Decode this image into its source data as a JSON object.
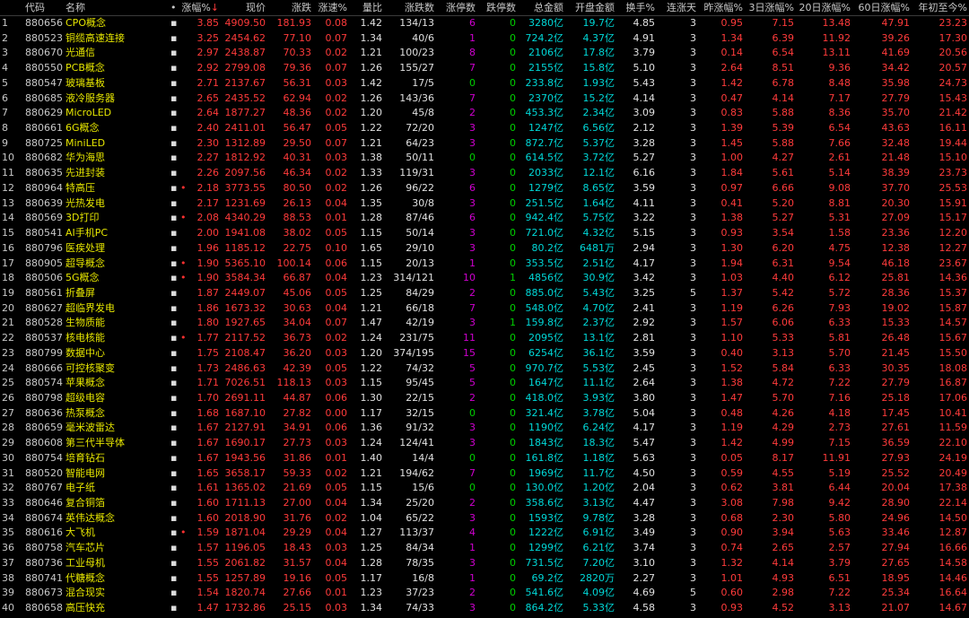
{
  "header": {
    "index": "",
    "code": "代码",
    "name": "名称",
    "flag": "•",
    "pct": "涨幅%",
    "pct_sort": "↓",
    "price": "现价",
    "chg": "涨跌",
    "speed": "涨速%",
    "volratio": "量比",
    "updown": "涨跌数",
    "up_limit": "涨停数",
    "down_limit": "跌停数",
    "amount": "总金额",
    "open_amount": "开盘金额",
    "turnover": "换手%",
    "consec": "连涨天",
    "ypct": "昨涨幅%",
    "pct3": "3日涨幅%",
    "pct20": "20日涨幅%",
    "pct60": "60日涨幅%",
    "ytd": "年初至今%"
  },
  "rows": [
    {
      "i": "1",
      "code": "880656",
      "name": "CPO概念",
      "m": "▪",
      "dot": "",
      "pct": "3.85",
      "price": "4909.50",
      "chg": "181.93",
      "speed": "0.08",
      "vr": "1.42",
      "ud": "134/13",
      "ul": "6",
      "dl": "0",
      "amt": "3280亿",
      "oamt": "19.7亿",
      "to": "4.85",
      "cd": "3",
      "yp": "0.95",
      "p3": "7.15",
      "p20": "13.48",
      "p60": "47.91",
      "ytd": "23.23"
    },
    {
      "i": "2",
      "code": "880523",
      "name": "铜缆高速连接",
      "m": "▪",
      "dot": "",
      "pct": "3.25",
      "price": "2454.62",
      "chg": "77.10",
      "speed": "0.07",
      "vr": "1.34",
      "ud": "40/6",
      "ul": "1",
      "dl": "0",
      "amt": "724.2亿",
      "oamt": "4.37亿",
      "to": "4.91",
      "cd": "3",
      "yp": "1.34",
      "p3": "6.39",
      "p20": "11.92",
      "p60": "39.26",
      "ytd": "17.30"
    },
    {
      "i": "3",
      "code": "880670",
      "name": "光通信",
      "m": "▪",
      "dot": "",
      "pct": "2.97",
      "price": "2438.87",
      "chg": "70.33",
      "speed": "0.02",
      "vr": "1.21",
      "ud": "100/23",
      "ul": "8",
      "dl": "0",
      "amt": "2106亿",
      "oamt": "17.8亿",
      "to": "3.79",
      "cd": "3",
      "yp": "0.14",
      "p3": "6.54",
      "p20": "13.11",
      "p60": "41.69",
      "ytd": "20.56"
    },
    {
      "i": "4",
      "code": "880550",
      "name": "PCB概念",
      "m": "▪",
      "dot": "",
      "pct": "2.92",
      "price": "2799.08",
      "chg": "79.36",
      "speed": "0.07",
      "vr": "1.26",
      "ud": "155/27",
      "ul": "7",
      "dl": "0",
      "amt": "2155亿",
      "oamt": "15.8亿",
      "to": "5.10",
      "cd": "3",
      "yp": "2.64",
      "p3": "8.51",
      "p20": "9.36",
      "p60": "34.42",
      "ytd": "20.57"
    },
    {
      "i": "5",
      "code": "880547",
      "name": "玻璃基板",
      "m": "▪",
      "dot": "",
      "pct": "2.71",
      "price": "2137.67",
      "chg": "56.31",
      "speed": "0.03",
      "vr": "1.42",
      "ud": "17/5",
      "ul": "0",
      "dl": "0",
      "amt": "233.8亿",
      "oamt": "1.93亿",
      "to": "5.43",
      "cd": "3",
      "yp": "1.42",
      "p3": "6.78",
      "p20": "8.48",
      "p60": "35.98",
      "ytd": "24.73"
    },
    {
      "i": "6",
      "code": "880685",
      "name": "液冷服务器",
      "m": "▪",
      "dot": "",
      "pct": "2.65",
      "price": "2435.52",
      "chg": "62.94",
      "speed": "0.02",
      "vr": "1.26",
      "ud": "143/36",
      "ul": "7",
      "dl": "0",
      "amt": "2370亿",
      "oamt": "15.2亿",
      "to": "4.14",
      "cd": "3",
      "yp": "0.47",
      "p3": "4.14",
      "p20": "7.17",
      "p60": "27.79",
      "ytd": "15.43"
    },
    {
      "i": "7",
      "code": "880629",
      "name": "MicroLED",
      "m": "▪",
      "dot": "",
      "pct": "2.64",
      "price": "1877.27",
      "chg": "48.36",
      "speed": "0.02",
      "vr": "1.20",
      "ud": "45/8",
      "ul": "2",
      "dl": "0",
      "amt": "453.3亿",
      "oamt": "2.34亿",
      "to": "3.09",
      "cd": "3",
      "yp": "0.83",
      "p3": "5.88",
      "p20": "8.36",
      "p60": "35.70",
      "ytd": "21.42"
    },
    {
      "i": "8",
      "code": "880661",
      "name": "6G概念",
      "m": "▪",
      "dot": "",
      "pct": "2.40",
      "price": "2411.01",
      "chg": "56.47",
      "speed": "0.05",
      "vr": "1.22",
      "ud": "72/20",
      "ul": "3",
      "dl": "0",
      "amt": "1247亿",
      "oamt": "6.56亿",
      "to": "2.12",
      "cd": "3",
      "yp": "1.39",
      "p3": "5.39",
      "p20": "6.54",
      "p60": "43.63",
      "ytd": "16.11"
    },
    {
      "i": "9",
      "code": "880725",
      "name": "MiniLED",
      "m": "▪",
      "dot": "",
      "pct": "2.30",
      "price": "1312.89",
      "chg": "29.50",
      "speed": "0.07",
      "vr": "1.21",
      "ud": "64/23",
      "ul": "3",
      "dl": "0",
      "amt": "872.7亿",
      "oamt": "5.37亿",
      "to": "3.28",
      "cd": "3",
      "yp": "1.45",
      "p3": "5.88",
      "p20": "7.66",
      "p60": "32.48",
      "ytd": "19.44"
    },
    {
      "i": "10",
      "code": "880682",
      "name": "华为海思",
      "m": "▪",
      "dot": "",
      "pct": "2.27",
      "price": "1812.92",
      "chg": "40.31",
      "speed": "0.03",
      "vr": "1.38",
      "ud": "50/11",
      "ul": "0",
      "dl": "0",
      "amt": "614.5亿",
      "oamt": "3.72亿",
      "to": "5.27",
      "cd": "3",
      "yp": "1.00",
      "p3": "4.27",
      "p20": "2.61",
      "p60": "21.48",
      "ytd": "15.10"
    },
    {
      "i": "11",
      "code": "880635",
      "name": "先进封装",
      "m": "▪",
      "dot": "",
      "pct": "2.26",
      "price": "2097.56",
      "chg": "46.34",
      "speed": "0.02",
      "vr": "1.33",
      "ud": "119/31",
      "ul": "3",
      "dl": "0",
      "amt": "2033亿",
      "oamt": "12.1亿",
      "to": "6.16",
      "cd": "3",
      "yp": "1.84",
      "p3": "5.61",
      "p20": "5.14",
      "p60": "38.39",
      "ytd": "23.73"
    },
    {
      "i": "12",
      "code": "880964",
      "name": "特高压",
      "m": "▪",
      "dot": "•",
      "pct": "2.18",
      "price": "3773.55",
      "chg": "80.50",
      "speed": "0.02",
      "vr": "1.26",
      "ud": "96/22",
      "ul": "6",
      "dl": "0",
      "amt": "1279亿",
      "oamt": "8.65亿",
      "to": "3.59",
      "cd": "3",
      "yp": "0.97",
      "p3": "6.66",
      "p20": "9.08",
      "p60": "37.70",
      "ytd": "25.53"
    },
    {
      "i": "13",
      "code": "880639",
      "name": "光热发电",
      "m": "▪",
      "dot": "",
      "pct": "2.17",
      "price": "1231.69",
      "chg": "26.13",
      "speed": "0.04",
      "vr": "1.35",
      "ud": "30/8",
      "ul": "3",
      "dl": "0",
      "amt": "251.5亿",
      "oamt": "1.64亿",
      "to": "4.11",
      "cd": "3",
      "yp": "0.41",
      "p3": "5.20",
      "p20": "8.81",
      "p60": "20.30",
      "ytd": "15.91"
    },
    {
      "i": "14",
      "code": "880569",
      "name": "3D打印",
      "m": "▪",
      "dot": "•",
      "pct": "2.08",
      "price": "4340.29",
      "chg": "88.53",
      "speed": "0.01",
      "vr": "1.28",
      "ud": "87/46",
      "ul": "6",
      "dl": "0",
      "amt": "942.4亿",
      "oamt": "5.75亿",
      "to": "3.22",
      "cd": "3",
      "yp": "1.38",
      "p3": "5.27",
      "p20": "5.31",
      "p60": "27.09",
      "ytd": "15.17"
    },
    {
      "i": "15",
      "code": "880541",
      "name": "AI手机PC",
      "m": "▪",
      "dot": "",
      "pct": "2.00",
      "price": "1941.08",
      "chg": "38.02",
      "speed": "0.05",
      "vr": "1.15",
      "ud": "50/14",
      "ul": "3",
      "dl": "0",
      "amt": "721.0亿",
      "oamt": "4.32亿",
      "to": "5.15",
      "cd": "3",
      "yp": "0.93",
      "p3": "3.54",
      "p20": "1.58",
      "p60": "23.36",
      "ytd": "12.20"
    },
    {
      "i": "16",
      "code": "880796",
      "name": "医疾处理",
      "m": "▪",
      "dot": "",
      "pct": "1.96",
      "price": "1185.12",
      "chg": "22.75",
      "speed": "0.10",
      "vr": "1.65",
      "ud": "29/10",
      "ul": "3",
      "dl": "0",
      "amt": "80.2亿",
      "oamt": "6481万",
      "to": "2.94",
      "cd": "3",
      "yp": "1.30",
      "p3": "6.20",
      "p20": "4.75",
      "p60": "12.38",
      "ytd": "12.27"
    },
    {
      "i": "17",
      "code": "880905",
      "name": "超导概念",
      "m": "▪",
      "dot": "•",
      "pct": "1.90",
      "price": "5365.10",
      "chg": "100.14",
      "speed": "0.06",
      "vr": "1.15",
      "ud": "20/13",
      "ul": "1",
      "dl": "0",
      "amt": "353.5亿",
      "oamt": "2.51亿",
      "to": "4.17",
      "cd": "3",
      "yp": "1.94",
      "p3": "6.31",
      "p20": "9.54",
      "p60": "46.18",
      "ytd": "23.67"
    },
    {
      "i": "18",
      "code": "880506",
      "name": "5G概念",
      "m": "▪",
      "dot": "•",
      "pct": "1.90",
      "price": "3584.34",
      "chg": "66.87",
      "speed": "0.04",
      "vr": "1.23",
      "ud": "314/121",
      "ul": "10",
      "dl": "1",
      "amt": "4856亿",
      "oamt": "30.9亿",
      "to": "3.42",
      "cd": "3",
      "yp": "1.03",
      "p3": "4.40",
      "p20": "6.12",
      "p60": "25.81",
      "ytd": "14.36"
    },
    {
      "i": "19",
      "code": "880561",
      "name": "折叠屏",
      "m": "▪",
      "dot": "",
      "pct": "1.87",
      "price": "2449.07",
      "chg": "45.06",
      "speed": "0.05",
      "vr": "1.25",
      "ud": "84/29",
      "ul": "2",
      "dl": "0",
      "amt": "885.0亿",
      "oamt": "5.43亿",
      "to": "3.25",
      "cd": "5",
      "yp": "1.37",
      "p3": "5.42",
      "p20": "5.72",
      "p60": "28.36",
      "ytd": "15.37"
    },
    {
      "i": "20",
      "code": "880627",
      "name": "超临界发电",
      "m": "▪",
      "dot": "",
      "pct": "1.86",
      "price": "1673.32",
      "chg": "30.63",
      "speed": "0.04",
      "vr": "1.21",
      "ud": "66/18",
      "ul": "7",
      "dl": "0",
      "amt": "548.0亿",
      "oamt": "4.70亿",
      "to": "2.41",
      "cd": "3",
      "yp": "1.19",
      "p3": "6.26",
      "p20": "7.93",
      "p60": "19.02",
      "ytd": "15.87"
    },
    {
      "i": "21",
      "code": "880528",
      "name": "生物质能",
      "m": "▪",
      "dot": "",
      "pct": "1.80",
      "price": "1927.65",
      "chg": "34.04",
      "speed": "0.07",
      "vr": "1.47",
      "ud": "42/19",
      "ul": "3",
      "dl": "1",
      "amt": "159.8亿",
      "oamt": "2.37亿",
      "to": "2.92",
      "cd": "3",
      "yp": "1.57",
      "p3": "6.06",
      "p20": "6.33",
      "p60": "15.33",
      "ytd": "14.57"
    },
    {
      "i": "22",
      "code": "880537",
      "name": "核电核能",
      "m": "▪",
      "dot": "•",
      "pct": "1.77",
      "price": "2117.52",
      "chg": "36.73",
      "speed": "0.02",
      "vr": "1.24",
      "ud": "231/75",
      "ul": "11",
      "dl": "0",
      "amt": "2095亿",
      "oamt": "13.1亿",
      "to": "2.81",
      "cd": "3",
      "yp": "1.10",
      "p3": "5.33",
      "p20": "5.81",
      "p60": "26.48",
      "ytd": "15.67"
    },
    {
      "i": "23",
      "code": "880799",
      "name": "数据中心",
      "m": "▪",
      "dot": "",
      "pct": "1.75",
      "price": "2108.47",
      "chg": "36.20",
      "speed": "0.03",
      "vr": "1.20",
      "ud": "374/195",
      "ul": "15",
      "dl": "0",
      "amt": "6254亿",
      "oamt": "36.1亿",
      "to": "3.59",
      "cd": "3",
      "yp": "0.40",
      "p3": "3.13",
      "p20": "5.70",
      "p60": "21.45",
      "ytd": "15.50"
    },
    {
      "i": "24",
      "code": "880666",
      "name": "可控核聚变",
      "m": "▪",
      "dot": "",
      "pct": "1.73",
      "price": "2486.63",
      "chg": "42.39",
      "speed": "0.05",
      "vr": "1.22",
      "ud": "74/32",
      "ul": "5",
      "dl": "0",
      "amt": "970.7亿",
      "oamt": "5.53亿",
      "to": "2.45",
      "cd": "3",
      "yp": "1.52",
      "p3": "5.84",
      "p20": "6.33",
      "p60": "30.35",
      "ytd": "18.08"
    },
    {
      "i": "25",
      "code": "880574",
      "name": "苹果概念",
      "m": "▪",
      "dot": "",
      "pct": "1.71",
      "price": "7026.51",
      "chg": "118.13",
      "speed": "0.03",
      "vr": "1.15",
      "ud": "95/45",
      "ul": "5",
      "dl": "0",
      "amt": "1647亿",
      "oamt": "11.1亿",
      "to": "2.64",
      "cd": "3",
      "yp": "1.38",
      "p3": "4.72",
      "p20": "7.22",
      "p60": "27.79",
      "ytd": "16.87"
    },
    {
      "i": "26",
      "code": "880798",
      "name": "超级电容",
      "m": "▪",
      "dot": "",
      "pct": "1.70",
      "price": "2691.11",
      "chg": "44.87",
      "speed": "0.06",
      "vr": "1.30",
      "ud": "22/15",
      "ul": "2",
      "dl": "0",
      "amt": "418.0亿",
      "oamt": "3.93亿",
      "to": "3.80",
      "cd": "3",
      "yp": "1.47",
      "p3": "5.70",
      "p20": "7.16",
      "p60": "25.18",
      "ytd": "17.06"
    },
    {
      "i": "27",
      "code": "880636",
      "name": "热泵概念",
      "m": "▪",
      "dot": "",
      "pct": "1.68",
      "price": "1687.10",
      "chg": "27.82",
      "speed": "0.00",
      "vr": "1.17",
      "ud": "32/15",
      "ul": "0",
      "dl": "0",
      "amt": "321.4亿",
      "oamt": "3.78亿",
      "to": "5.04",
      "cd": "3",
      "yp": "0.48",
      "p3": "4.26",
      "p20": "4.18",
      "p60": "17.45",
      "ytd": "10.41"
    },
    {
      "i": "28",
      "code": "880659",
      "name": "毫米波雷达",
      "m": "▪",
      "dot": "",
      "pct": "1.67",
      "price": "2127.91",
      "chg": "34.91",
      "speed": "0.06",
      "vr": "1.36",
      "ud": "91/32",
      "ul": "3",
      "dl": "0",
      "amt": "1190亿",
      "oamt": "6.24亿",
      "to": "4.17",
      "cd": "3",
      "yp": "1.19",
      "p3": "4.29",
      "p20": "2.73",
      "p60": "27.61",
      "ytd": "11.59"
    },
    {
      "i": "29",
      "code": "880608",
      "name": "第三代半导体",
      "m": "▪",
      "dot": "",
      "pct": "1.67",
      "price": "1690.17",
      "chg": "27.73",
      "speed": "0.03",
      "vr": "1.24",
      "ud": "124/41",
      "ul": "3",
      "dl": "0",
      "amt": "1843亿",
      "oamt": "18.3亿",
      "to": "5.47",
      "cd": "3",
      "yp": "1.42",
      "p3": "4.99",
      "p20": "7.15",
      "p60": "36.59",
      "ytd": "22.10"
    },
    {
      "i": "30",
      "code": "880754",
      "name": "培育钻石",
      "m": "▪",
      "dot": "",
      "pct": "1.67",
      "price": "1943.56",
      "chg": "31.86",
      "speed": "0.01",
      "vr": "1.40",
      "ud": "14/4",
      "ul": "0",
      "dl": "0",
      "amt": "161.8亿",
      "oamt": "1.18亿",
      "to": "5.63",
      "cd": "3",
      "yp": "0.05",
      "p3": "8.17",
      "p20": "11.91",
      "p60": "27.93",
      "ytd": "24.19"
    },
    {
      "i": "31",
      "code": "880520",
      "name": "智能电网",
      "m": "▪",
      "dot": "",
      "pct": "1.65",
      "price": "3658.17",
      "chg": "59.33",
      "speed": "0.02",
      "vr": "1.21",
      "ud": "194/62",
      "ul": "7",
      "dl": "0",
      "amt": "1969亿",
      "oamt": "11.7亿",
      "to": "4.50",
      "cd": "3",
      "yp": "0.59",
      "p3": "4.55",
      "p20": "5.19",
      "p60": "25.52",
      "ytd": "20.49"
    },
    {
      "i": "32",
      "code": "880767",
      "name": "电子纸",
      "m": "▪",
      "dot": "",
      "pct": "1.61",
      "price": "1365.02",
      "chg": "21.69",
      "speed": "0.05",
      "vr": "1.15",
      "ud": "15/6",
      "ul": "0",
      "dl": "0",
      "amt": "130.0亿",
      "oamt": "1.20亿",
      "to": "2.04",
      "cd": "3",
      "yp": "0.62",
      "p3": "3.81",
      "p20": "6.44",
      "p60": "20.04",
      "ytd": "17.38"
    },
    {
      "i": "33",
      "code": "880646",
      "name": "复合铜箔",
      "m": "▪",
      "dot": "",
      "pct": "1.60",
      "price": "1711.13",
      "chg": "27.00",
      "speed": "0.04",
      "vr": "1.34",
      "ud": "25/20",
      "ul": "2",
      "dl": "0",
      "amt": "358.6亿",
      "oamt": "3.13亿",
      "to": "4.47",
      "cd": "3",
      "yp": "3.08",
      "p3": "7.98",
      "p20": "9.42",
      "p60": "28.90",
      "ytd": "22.14"
    },
    {
      "i": "34",
      "code": "880674",
      "name": "英伟达概念",
      "m": "▪",
      "dot": "",
      "pct": "1.60",
      "price": "2018.90",
      "chg": "31.76",
      "speed": "0.02",
      "vr": "1.04",
      "ud": "65/22",
      "ul": "3",
      "dl": "0",
      "amt": "1593亿",
      "oamt": "9.78亿",
      "to": "3.28",
      "cd": "3",
      "yp": "0.68",
      "p3": "2.30",
      "p20": "5.80",
      "p60": "24.96",
      "ytd": "14.50"
    },
    {
      "i": "35",
      "code": "880616",
      "name": "大飞机",
      "m": "▪",
      "dot": "•",
      "pct": "1.59",
      "price": "1871.04",
      "chg": "29.29",
      "speed": "0.04",
      "vr": "1.27",
      "ud": "113/37",
      "ul": "4",
      "dl": "0",
      "amt": "1222亿",
      "oamt": "6.91亿",
      "to": "3.49",
      "cd": "3",
      "yp": "0.90",
      "p3": "3.94",
      "p20": "5.63",
      "p60": "33.46",
      "ytd": "12.87"
    },
    {
      "i": "36",
      "code": "880758",
      "name": "汽车芯片",
      "m": "▪",
      "dot": "",
      "pct": "1.57",
      "price": "1196.05",
      "chg": "18.43",
      "speed": "0.03",
      "vr": "1.25",
      "ud": "84/34",
      "ul": "1",
      "dl": "0",
      "amt": "1299亿",
      "oamt": "6.21亿",
      "to": "3.74",
      "cd": "3",
      "yp": "0.74",
      "p3": "2.65",
      "p20": "2.57",
      "p60": "27.94",
      "ytd": "16.66"
    },
    {
      "i": "37",
      "code": "880736",
      "name": "工业母机",
      "m": "▪",
      "dot": "",
      "pct": "1.55",
      "price": "2061.82",
      "chg": "31.57",
      "speed": "0.04",
      "vr": "1.28",
      "ud": "78/35",
      "ul": "3",
      "dl": "0",
      "amt": "731.5亿",
      "oamt": "7.20亿",
      "to": "3.10",
      "cd": "3",
      "yp": "1.32",
      "p3": "4.14",
      "p20": "3.79",
      "p60": "27.65",
      "ytd": "14.58"
    },
    {
      "i": "38",
      "code": "880741",
      "name": "代糖概念",
      "m": "▪",
      "dot": "",
      "pct": "1.55",
      "price": "1257.89",
      "chg": "19.16",
      "speed": "0.05",
      "vr": "1.17",
      "ud": "16/8",
      "ul": "1",
      "dl": "0",
      "amt": "69.2亿",
      "oamt": "2820万",
      "to": "2.27",
      "cd": "3",
      "yp": "1.01",
      "p3": "4.93",
      "p20": "6.51",
      "p60": "18.95",
      "ytd": "14.46"
    },
    {
      "i": "39",
      "code": "880673",
      "name": "混合现实",
      "m": "▪",
      "dot": "",
      "pct": "1.54",
      "price": "1820.74",
      "chg": "27.66",
      "speed": "0.01",
      "vr": "1.23",
      "ud": "37/23",
      "ul": "2",
      "dl": "0",
      "amt": "541.6亿",
      "oamt": "4.09亿",
      "to": "4.69",
      "cd": "5",
      "yp": "0.60",
      "p3": "2.98",
      "p20": "7.22",
      "p60": "25.34",
      "ytd": "16.64"
    },
    {
      "i": "40",
      "code": "880658",
      "name": "高压快充",
      "m": "▪",
      "dot": "",
      "pct": "1.47",
      "price": "1732.86",
      "chg": "25.15",
      "speed": "0.03",
      "vr": "1.34",
      "ud": "74/33",
      "ul": "3",
      "dl": "0",
      "amt": "864.2亿",
      "oamt": "5.33亿",
      "to": "4.58",
      "cd": "3",
      "yp": "0.93",
      "p3": "4.52",
      "p20": "3.13",
      "p60": "21.07",
      "ytd": "14.67"
    }
  ]
}
